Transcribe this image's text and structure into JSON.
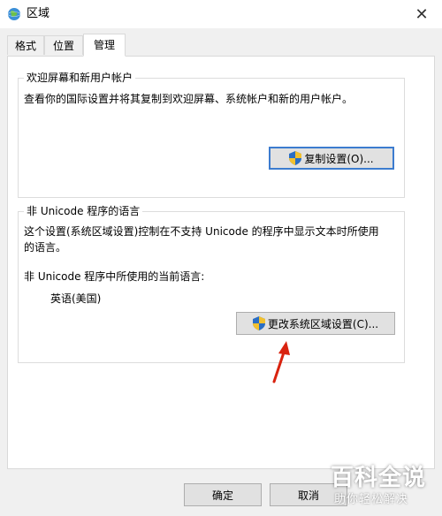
{
  "window": {
    "title": "区域",
    "close_glyph": "✕"
  },
  "tabs": [
    {
      "label": "格式"
    },
    {
      "label": "位置"
    },
    {
      "label": "管理",
      "active": true
    }
  ],
  "welcome_group": {
    "title": "欢迎屏幕和新用户帐户",
    "description": "查看你的国际设置并将其复制到欢迎屏幕、系统帐户和新的用户帐户。",
    "copy_button": "复制设置(O)..."
  },
  "unicode_group": {
    "title": "非 Unicode 程序的语言",
    "description_line1": "这个设置(系统区域设置)控制在不支持 Unicode 的程序中显示文本时所使用",
    "description_line2": "的语言。",
    "current_label": "非 Unicode 程序中所使用的当前语言:",
    "current_value": "英语(美国)",
    "change_button": "更改系统区域设置(C)..."
  },
  "footer": {
    "ok_label": "确定",
    "cancel_label": "取消"
  },
  "watermark": {
    "main": "百科全说",
    "sub": "助你轻松解决"
  },
  "colors": {
    "accent_border": "#3c7ccf",
    "arrow": "#d9230f",
    "shield_blue": "#2a6ec4",
    "shield_yellow": "#f2c12e"
  },
  "icons": {
    "window_icon": "globe-icon",
    "button_icon": "uac-shield-icon",
    "annotation": "red-arrow-icon"
  }
}
